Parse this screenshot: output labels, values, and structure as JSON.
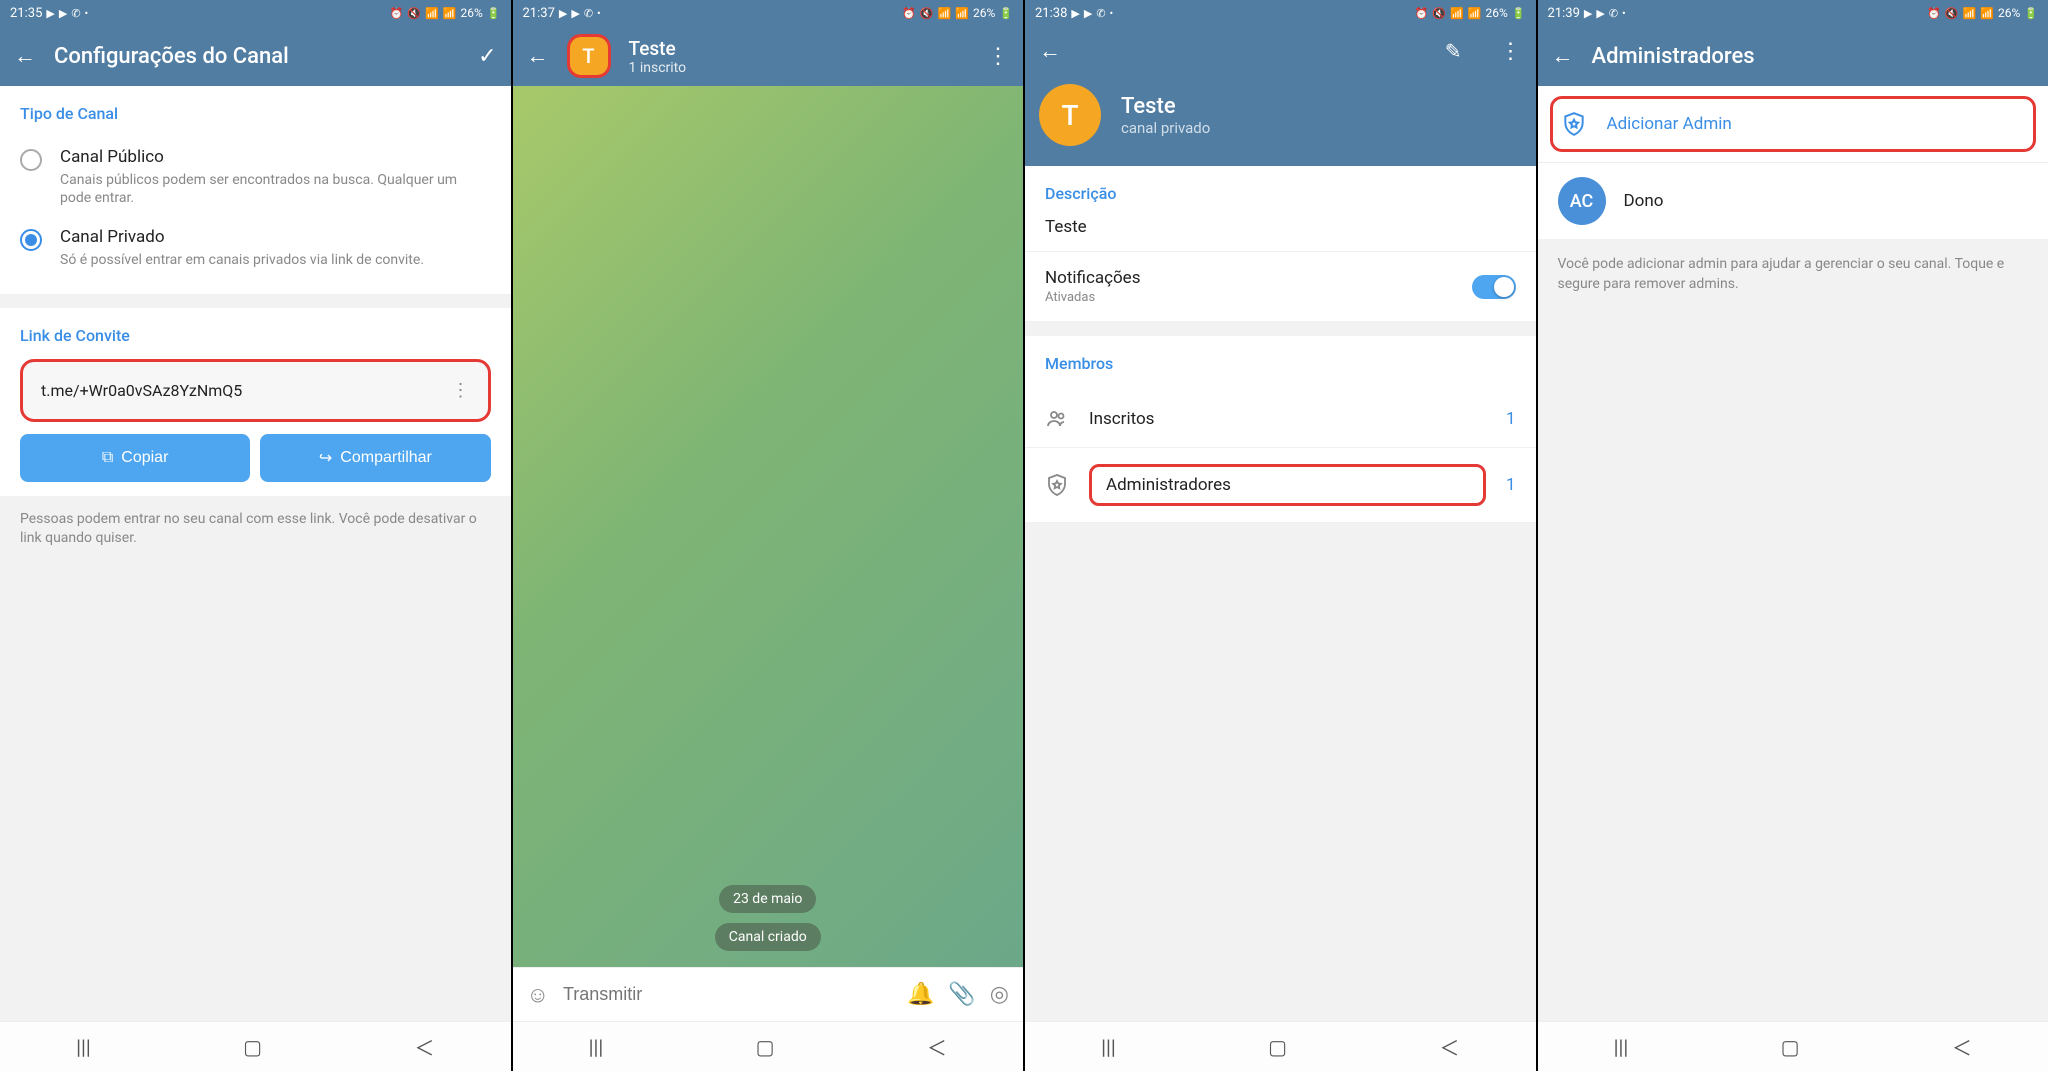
{
  "screen1": {
    "status": {
      "time": "21:35",
      "battery": "26%"
    },
    "title": "Configurações do Canal",
    "section_type": "Tipo de Canal",
    "public": {
      "label": "Canal Público",
      "desc": "Canais públicos podem ser encontrados na busca. Qualquer um pode entrar."
    },
    "private": {
      "label": "Canal Privado",
      "desc": "Só é possível entrar em canais privados via link de convite."
    },
    "section_link": "Link de Convite",
    "invite_link": "t.me/+Wr0a0vSAz8YzNmQ5",
    "copy": "Copiar",
    "share": "Compartilhar",
    "link_desc": "Pessoas podem entrar no seu canal com esse link. Você pode desativar o link quando quiser."
  },
  "screen2": {
    "status": {
      "time": "21:37",
      "battery": "26%"
    },
    "channel_name": "Teste",
    "channel_sub": "1 inscrito",
    "avatar_letter": "T",
    "date_pill": "23 de maio",
    "created_pill": "Canal criado",
    "input_placeholder": "Transmitir"
  },
  "screen3": {
    "status": {
      "time": "21:38",
      "battery": "26%"
    },
    "channel_name": "Teste",
    "channel_sub": "canal privado",
    "avatar_letter": "T",
    "desc_title": "Descrição",
    "desc_value": "Teste",
    "notif_label": "Notificações",
    "notif_value": "Ativadas",
    "members_title": "Membros",
    "subscribers": {
      "label": "Inscritos",
      "count": "1"
    },
    "admins": {
      "label": "Administradores",
      "count": "1"
    }
  },
  "screen4": {
    "status": {
      "time": "21:39",
      "battery": "26%"
    },
    "title": "Administradores",
    "add_admin": "Adicionar Admin",
    "owner": {
      "initials": "AC",
      "label": "Dono"
    },
    "help": "Você pode adicionar admin para ajudar a gerenciar o seu canal. Toque e segure para remover admins."
  }
}
